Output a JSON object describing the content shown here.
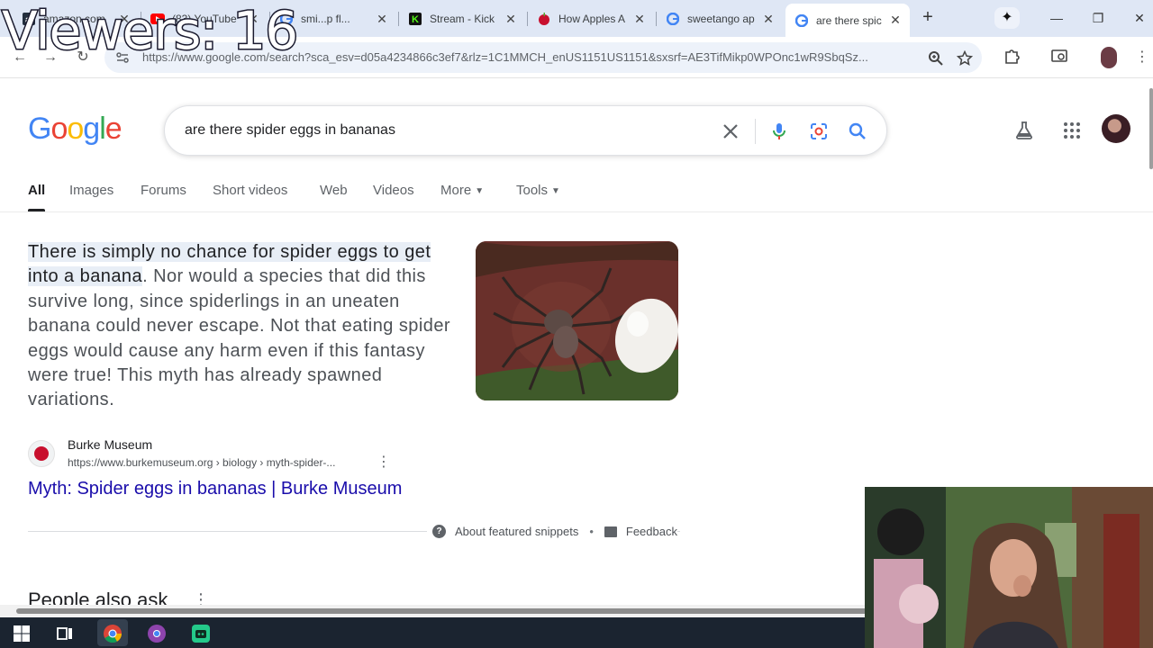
{
  "overlay": {
    "viewers": "Viewers: 16"
  },
  "browser": {
    "tabs": [
      {
        "title": "amazon.com",
        "favicon": "amazon-icon",
        "active": false
      },
      {
        "title": "(83) YouTube",
        "favicon": "youtube-icon",
        "active": false
      },
      {
        "title": "smi...p fl...",
        "favicon": "google-icon",
        "active": false
      },
      {
        "title": "Stream - Kick",
        "favicon": "kick-icon",
        "active": false
      },
      {
        "title": "How Apples A",
        "favicon": "apple-icon",
        "active": false
      },
      {
        "title": "sweetango ap",
        "favicon": "google-icon",
        "active": false
      },
      {
        "title": "are there spic",
        "favicon": "google-icon",
        "active": true
      }
    ],
    "url": "https://www.google.com/search?sca_esv=d05a4234866c3ef7&rlz=1C1MMCH_enUS1151US1151&sxsrf=AE3TifMikp0WPOnc1wR9SbqSz..."
  },
  "google": {
    "logo_letters": [
      "G",
      "o",
      "o",
      "g",
      "l",
      "e"
    ],
    "query": "are there spider eggs in bananas",
    "tabs": [
      "All",
      "Images",
      "Forums",
      "Short videos",
      "Web",
      "Videos",
      "More",
      "Tools"
    ]
  },
  "snippet": {
    "highlight": "There is simply no chance for spider eggs to get into a banana",
    "text": ". Nor would a species that did this survive long, since spiderlings in an uneaten banana could never escape. Not that eating spider eggs would cause any harm even if this fantasy were true! This myth has already spawned variations.",
    "source_name": "Burke Museum",
    "source_url": "https://www.burkemuseum.org › biology › myth-spider-...",
    "link_title": "Myth: Spider eggs in bananas | Burke Museum",
    "about_label": "About featured snippets",
    "separator": "•",
    "feedback_label": "Feedback"
  },
  "people_also_ask": {
    "title": "People also ask",
    "menu": "⋮"
  },
  "colors": {
    "link": "#1a0dab",
    "google_blue": "#4285f4",
    "google_red": "#ea4335",
    "google_yellow": "#fbbc05",
    "google_green": "#34a853"
  }
}
